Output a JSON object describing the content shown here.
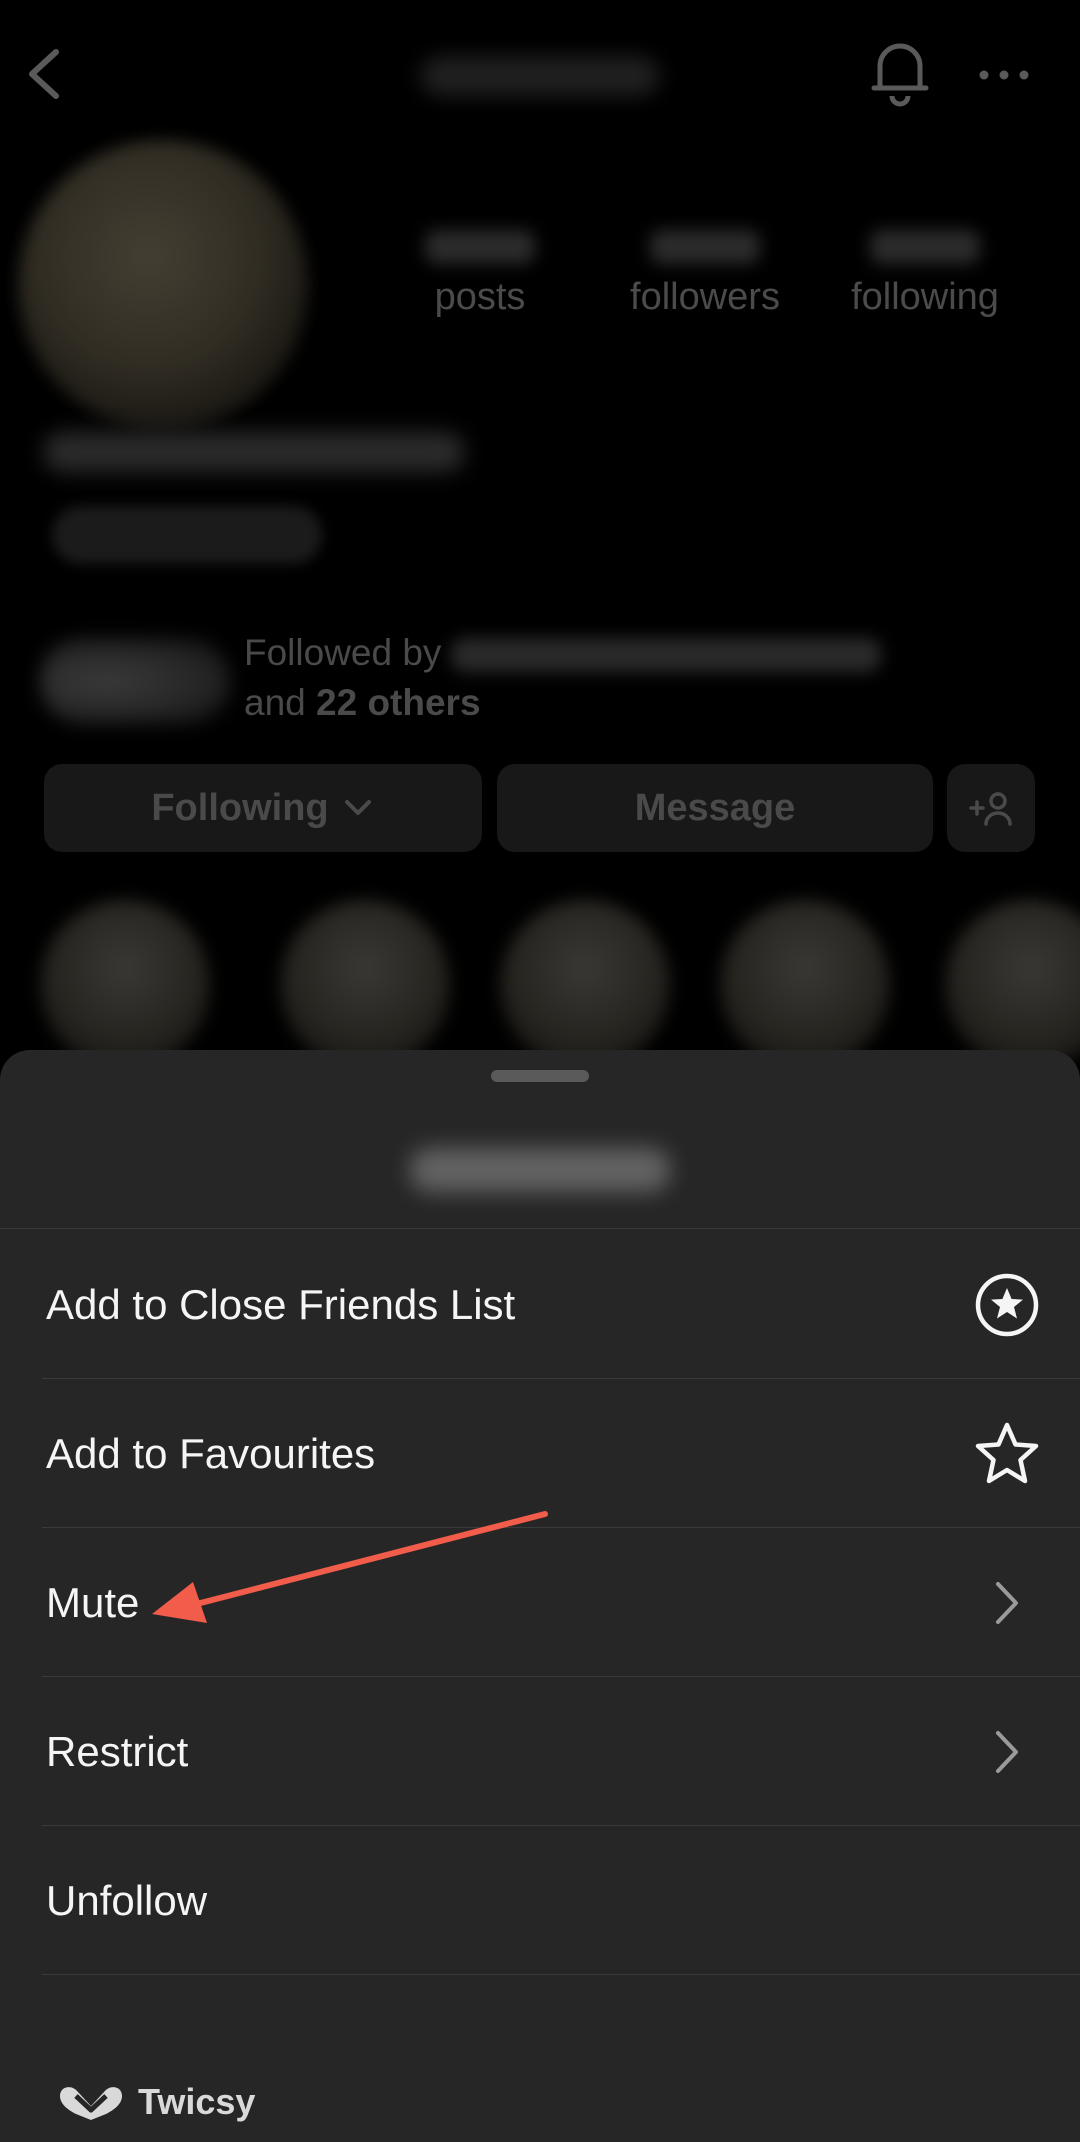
{
  "profile": {
    "stats": {
      "posts_label": "posts",
      "followers_label": "followers",
      "following_label": "following"
    },
    "followed_by_prefix": "Followed by",
    "followed_by_and": "and",
    "followed_by_count": "22 others",
    "buttons": {
      "following": "Following",
      "message": "Message"
    }
  },
  "sheet": {
    "items": [
      {
        "label": "Add to Close Friends List",
        "icon": "close-friends-star-circle-icon"
      },
      {
        "label": "Add to Favourites",
        "icon": "star-outline-icon"
      },
      {
        "label": "Mute",
        "icon": "chevron-right-icon"
      },
      {
        "label": "Restrict",
        "icon": "chevron-right-icon"
      },
      {
        "label": "Unfollow",
        "icon": ""
      }
    ]
  },
  "annotation": {
    "arrow_color": "#f25c4a"
  },
  "watermark": {
    "text": "Twicsy"
  }
}
